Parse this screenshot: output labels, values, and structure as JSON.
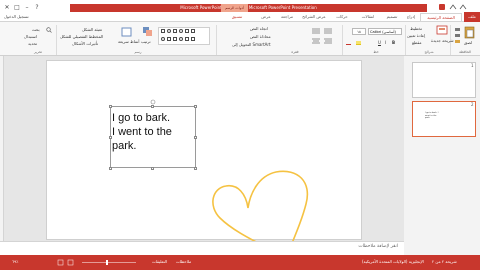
{
  "window": {
    "title": "Microsoft PowerPoint - pptx.تجريبي Microsoft PowerPoint Presentation",
    "drawing_tools": "أدوات الرسم",
    "minimize": "–",
    "maximize": "□",
    "close": "✕",
    "help": "?"
  },
  "tabs": {
    "file": "ملف",
    "home": "الصفحة الرئيسية",
    "insert": "إدراج",
    "design": "تصميم",
    "transitions": "انتقالات",
    "animations": "حركات",
    "slideshow": "عرض الشرائح",
    "review": "مراجعة",
    "view": "عرض",
    "format": "تنسيق",
    "user": "تسجيل الدخول"
  },
  "ribbon": {
    "paste": "لصق",
    "new_slide": "شريحة جديدة",
    "layout": "تخطيط",
    "reset": "إعادة تعيين",
    "section": "مقطع",
    "font_name": "Calibri (أساسي)",
    "font_size": "١٨",
    "bold": "B",
    "italic": "I",
    "underline": "U",
    "text_direction": "اتجاه النص",
    "align_text": "محاذاة النص",
    "convert_smartart": "التحويل إلى SmartArt",
    "arrange": "ترتيب",
    "quick_styles": "أنماط سريعة",
    "shape_fill": "تعبئة الشكل",
    "shape_outline": "المخطط التفصيلي للشكل",
    "shape_effects": "تأثيرات الأشكال",
    "find": "بحث",
    "replace": "استبدال",
    "select": "تحديد",
    "groups": {
      "clipboard": "الحافظة",
      "slides": "شرائح",
      "font": "خط",
      "paragraph": "فقرة",
      "drawing": "رسم",
      "editing": "تحرير"
    }
  },
  "thumbnails": [
    {
      "number": "1"
    },
    {
      "number": "2",
      "preview_text": "I go to bark. I went to the park."
    }
  ],
  "slide": {
    "lines": [
      "I go to bark.",
      "I went to the",
      "park."
    ]
  },
  "notes": {
    "placeholder": "انقر لإضافة ملاحظات"
  },
  "status": {
    "slide_info": "شريحة ٢ من ٢",
    "language": "الإنجليزية (الولايات المتحدة الأمريكية)",
    "notes_button": "ملاحظات",
    "comments_button": "التعليقات",
    "zoom": "٦٩٪"
  },
  "colors": {
    "accent": "#c8372d",
    "ink": "#f5c242"
  },
  "icons": [
    "paste-icon",
    "new-slide-icon",
    "shape-icon",
    "find-icon",
    "heart-ink-drawing"
  ]
}
